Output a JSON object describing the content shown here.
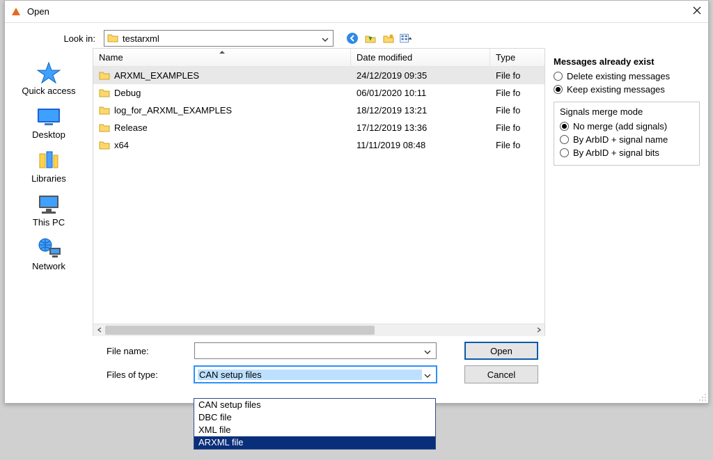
{
  "window": {
    "title": "Open"
  },
  "toolbar": {
    "lookin_label": "Look in:",
    "lookin_value": "testarxml"
  },
  "places": [
    {
      "label": "Quick access"
    },
    {
      "label": "Desktop"
    },
    {
      "label": "Libraries"
    },
    {
      "label": "This PC"
    },
    {
      "label": "Network"
    }
  ],
  "columns": {
    "name": "Name",
    "date": "Date modified",
    "type": "Type"
  },
  "files": [
    {
      "name": "ARXML_EXAMPLES",
      "date": "24/12/2019 09:35",
      "type": "File fo",
      "selected": true
    },
    {
      "name": "Debug",
      "date": "06/01/2020 10:11",
      "type": "File fo",
      "selected": false
    },
    {
      "name": "log_for_ARXML_EXAMPLES",
      "date": "18/12/2019 13:21",
      "type": "File fo",
      "selected": false
    },
    {
      "name": "Release",
      "date": "17/12/2019 13:36",
      "type": "File fo",
      "selected": false
    },
    {
      "name": "x64",
      "date": "11/11/2019 08:48",
      "type": "File fo",
      "selected": false
    }
  ],
  "right": {
    "group1_title": "Messages already exist",
    "opt_delete": "Delete existing messages",
    "opt_keep": "Keep existing messages",
    "group2_title": "Signals merge mode",
    "opt_nomerge": "No merge (add signals)",
    "opt_arbid_name": "By ArbID + signal name",
    "opt_arbid_bits": "By ArbID + signal bits"
  },
  "bottom": {
    "filename_label": "File name:",
    "filename_value": "",
    "filetype_label": "Files of type:",
    "filetype_value": "CAN setup files",
    "open_btn": "Open",
    "cancel_btn": "Cancel"
  },
  "filetype_options": [
    "CAN setup files",
    "DBC file",
    "XML file",
    "ARXML file"
  ]
}
